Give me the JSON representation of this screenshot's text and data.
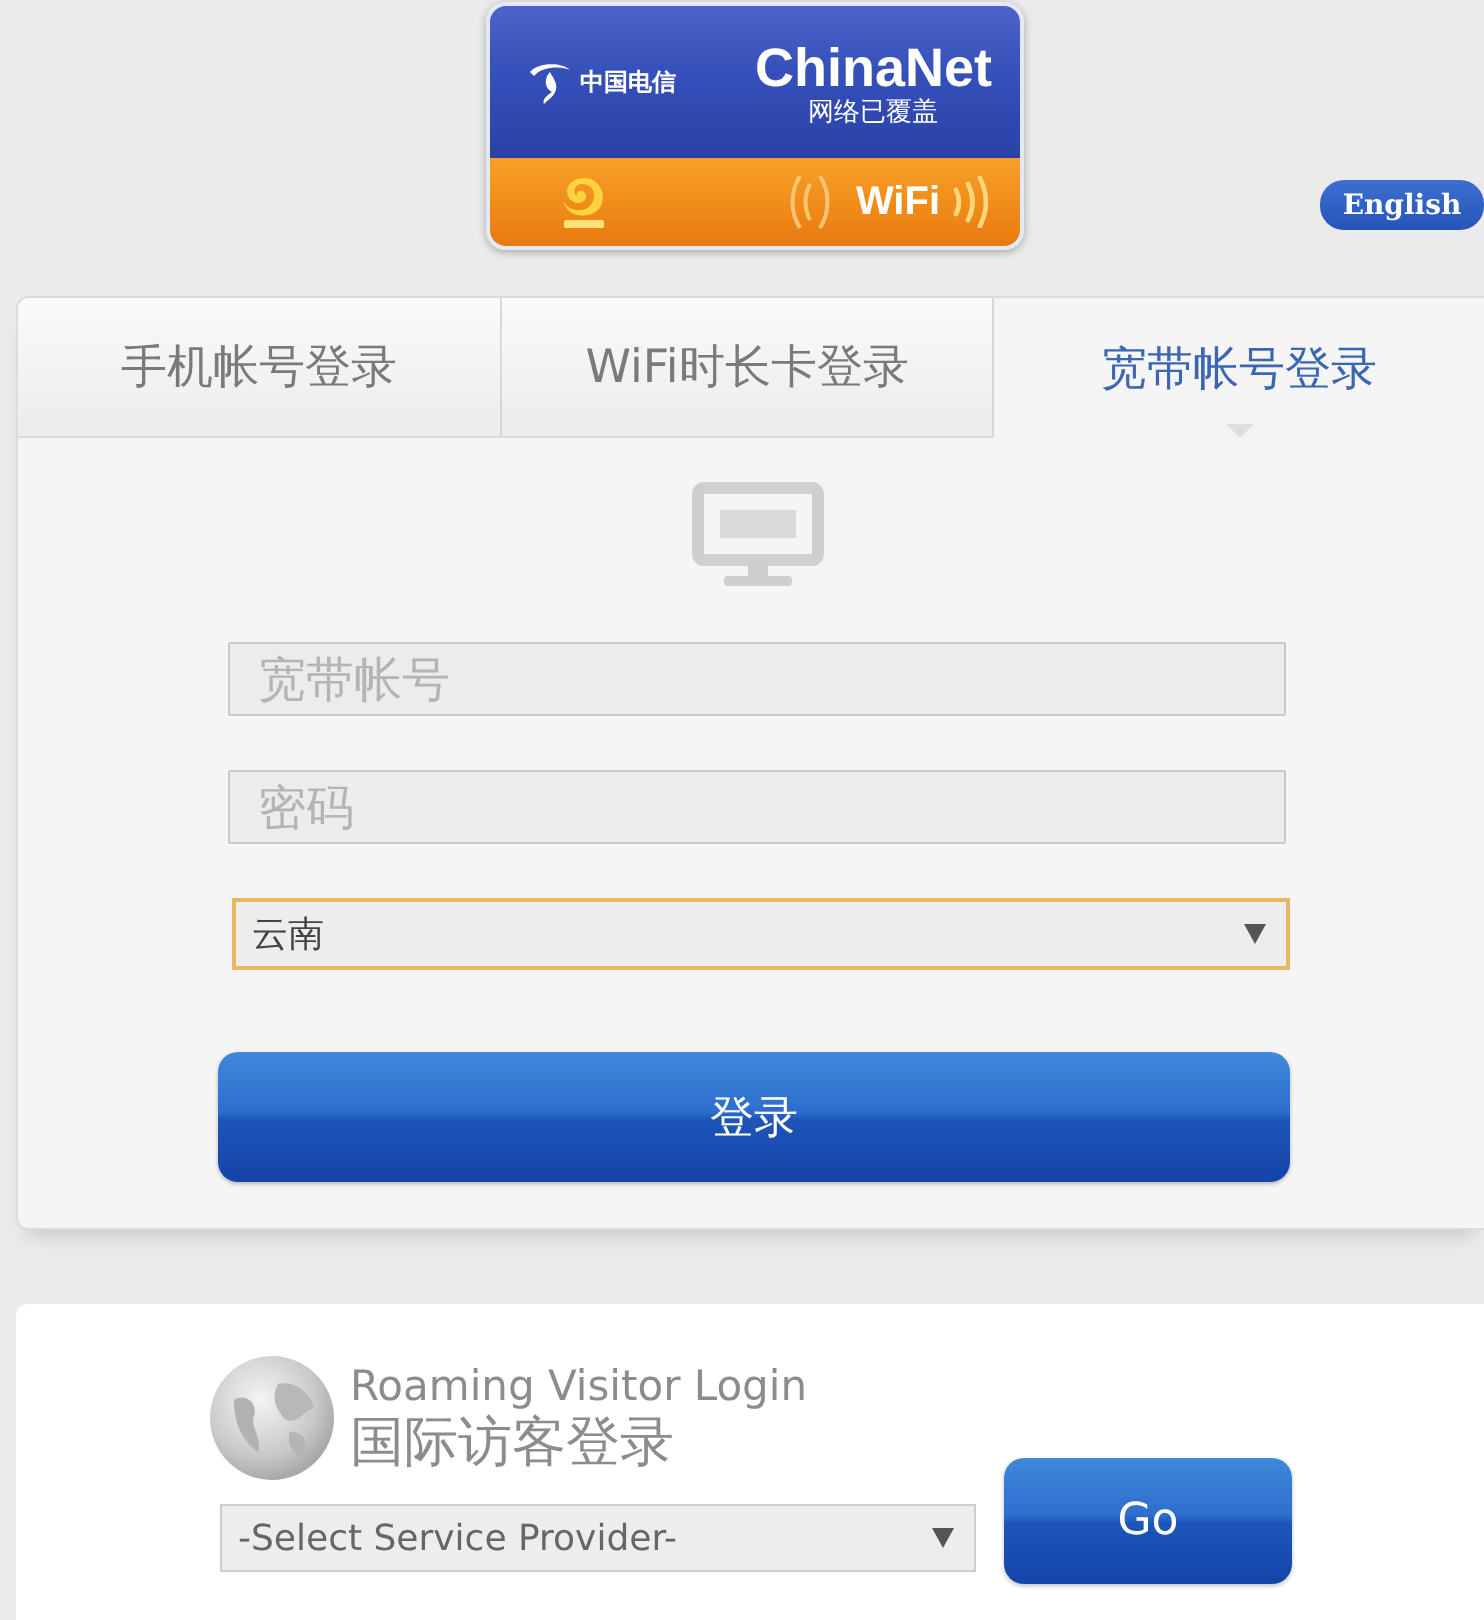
{
  "banner": {
    "carrier": "中国电信",
    "brand": "ChinaNet",
    "tagline": "网络已覆盖",
    "wifi": "WiFi"
  },
  "language_button": "English",
  "tabs": [
    {
      "label": "手机帐号登录",
      "selected": false
    },
    {
      "label": "WiFi时长卡登录",
      "selected": false
    },
    {
      "label": "宽带帐号登录",
      "selected": true
    }
  ],
  "login_form": {
    "account": {
      "placeholder": "宽带帐号"
    },
    "password": {
      "placeholder": "密码"
    },
    "region": {
      "value": "云南",
      "focused": true
    },
    "submit": "登录"
  },
  "roaming": {
    "title": "Roaming Visitor Login",
    "subtitle": "国际访客登录",
    "provider": {
      "value": "-Select Service Provider-",
      "focused": false
    },
    "submit": "Go"
  }
}
